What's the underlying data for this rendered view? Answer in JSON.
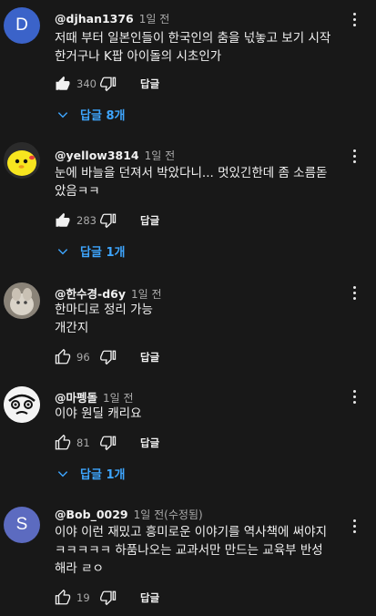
{
  "colors": {
    "background": "#181818",
    "text": "#f1f1f1",
    "secondary": "#aaaaaa",
    "link": "#3ea6ff",
    "avatar_d": "#3b63c9",
    "avatar_s": "#5c6bc0"
  },
  "comments": [
    {
      "author": "@djhan1376",
      "timestamp": "1일 전",
      "avatar_letter": "D",
      "text": "저때 부터 일본인들이 한국인의 춤을 넋놓고 보기 시작\n한거구나 K팝 아이돌의 시초인가",
      "likes": "340",
      "reply_label": "답글",
      "replies_label": "답글 8개"
    },
    {
      "author": "@yellow3814",
      "timestamp": "1일 전",
      "text": "눈에 바늘을 던져서 박았다니... 멋있긴한데 좀 소름돋\n았음ㅋㅋ",
      "likes": "283",
      "reply_label": "답글",
      "replies_label": "답글 1개"
    },
    {
      "author": "@한수경-d6y",
      "timestamp": "1일 전",
      "text": "한마디로 정리 가능\n개간지",
      "likes": "96",
      "reply_label": "답글"
    },
    {
      "author": "@마펭돌",
      "timestamp": "1일 전",
      "text": "이야 원딜 캐리요",
      "likes": "81",
      "reply_label": "답글",
      "replies_label": "답글 1개"
    },
    {
      "author": "@Bob_0029",
      "timestamp": "1일 전(수정됨)",
      "avatar_letter": "S",
      "text": "이야 이런 재밌고 흥미로운 이야기를 역사책에 써야지\nㅋㅋㅋㅋㅋ 하품나오는 교과서만 만드는 교육부 반성\n해라 ㄹㅇ",
      "likes": "19",
      "reply_label": "답글"
    }
  ]
}
